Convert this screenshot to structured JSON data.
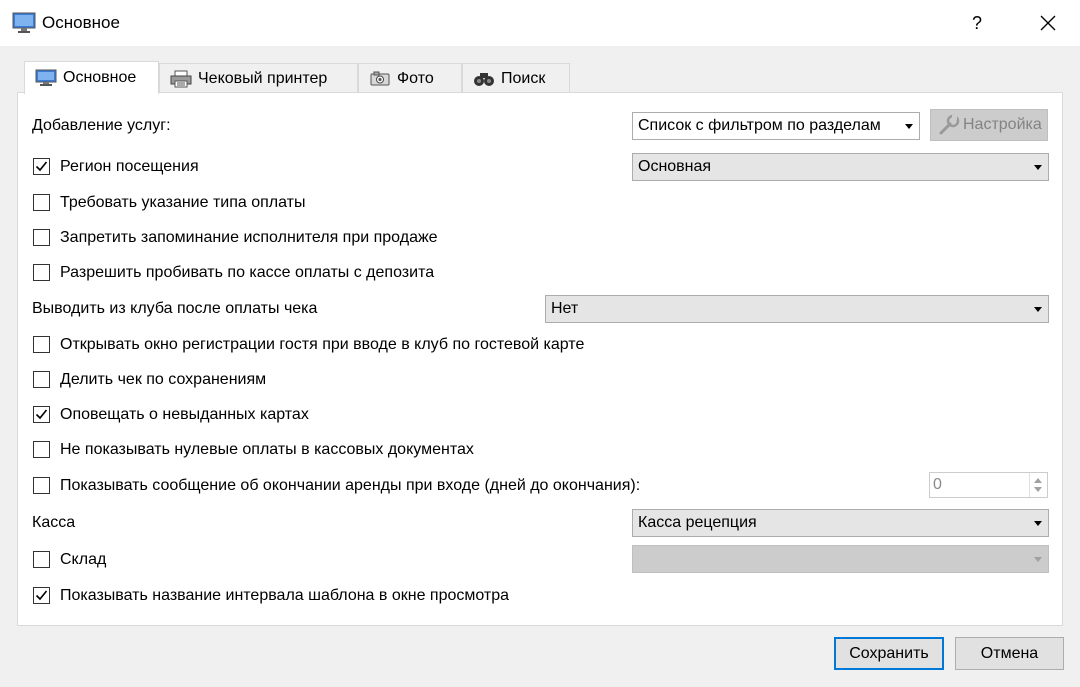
{
  "window": {
    "title": "Основное",
    "help_label": "?",
    "close_label": "✕"
  },
  "tabs": [
    {
      "label": "Основное",
      "icon": "monitor-icon",
      "active": true
    },
    {
      "label": "Чековый принтер",
      "icon": "printer-icon",
      "active": false
    },
    {
      "label": "Фото",
      "icon": "camera-icon",
      "active": false
    },
    {
      "label": "Поиск",
      "icon": "binoculars-icon",
      "active": false
    }
  ],
  "form": {
    "services_label": "Добавление услуг:",
    "services_value": "Список с фильтром по разделам",
    "settings_button": "Настройка",
    "region": {
      "label": "Регион посещения",
      "checked": true,
      "value": "Основная"
    },
    "require_payment_type": {
      "label": "Требовать указание типа оплаты",
      "checked": false
    },
    "forbid_remember_executor": {
      "label": "Запретить запоминание исполнителя при продаже",
      "checked": false
    },
    "allow_deposit_payments": {
      "label": "Разрешить пробивать по кассе оплаты с депозита",
      "checked": false
    },
    "exit_club_label": "Выводить из клуба после оплаты чека",
    "exit_club_value": "Нет",
    "open_guest_registration": {
      "label": "Открывать окно регистрации гостя при вводе в клуб по гостевой карте",
      "checked": false
    },
    "split_check": {
      "label": "Делить чек по сохранениям",
      "checked": false
    },
    "notify_unissued_cards": {
      "label": "Оповещать о невыданных картах",
      "checked": true
    },
    "hide_zero_payments": {
      "label": "Не показывать нулевые оплаты в кассовых документах",
      "checked": false
    },
    "rental_end_message": {
      "label": "Показывать сообщение об окончании аренды при входе (дней до окончания):",
      "checked": false,
      "days": "0"
    },
    "cash_label": "Касса",
    "cash_value": "Касса рецепция",
    "warehouse": {
      "label": "Склад",
      "checked": false,
      "value": ""
    },
    "show_interval_name": {
      "label": "Показывать название интервала шаблона в окне просмотра",
      "checked": true
    }
  },
  "footer": {
    "save_label": "Сохранить",
    "cancel_label": "Отмена"
  },
  "colors": {
    "accent": "#0078d7",
    "panel": "#ffffff",
    "window_bg": "#f0f0f0"
  }
}
